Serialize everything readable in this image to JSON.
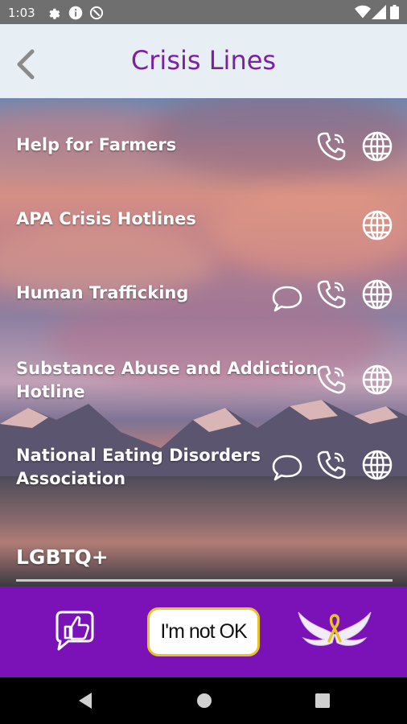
{
  "status_bar": {
    "time": "1:03"
  },
  "app_bar": {
    "title": "Crisis Lines"
  },
  "crisis_lines": [
    {
      "name_lines": [
        "Help for Farmers"
      ],
      "icons": [
        "phone-icon",
        "globe-icon"
      ]
    },
    {
      "name_lines": [
        "APA Crisis Hotlines"
      ],
      "icons": [
        "globe-icon"
      ]
    },
    {
      "name_lines": [
        "Human Trafficking"
      ],
      "icons": [
        "chat-bubble-icon",
        "phone-icon",
        "globe-icon"
      ]
    },
    {
      "name_lines": [
        "Substance Abuse and Addiction",
        "Hotline"
      ],
      "icons": [
        "phone-icon",
        "globe-icon"
      ]
    },
    {
      "name_lines": [
        "National Eating Disorders",
        "Association"
      ],
      "icons": [
        "chat-bubble-icon",
        "phone-icon",
        "globe-icon"
      ]
    }
  ],
  "section": {
    "title": "LGBTQ+"
  },
  "bottom_bar": {
    "not_ok_label": "I'm not OK"
  },
  "colors": {
    "accent_purple": "#7b12b8",
    "title_purple": "#7b1fa6",
    "button_border": "#e7c326"
  }
}
